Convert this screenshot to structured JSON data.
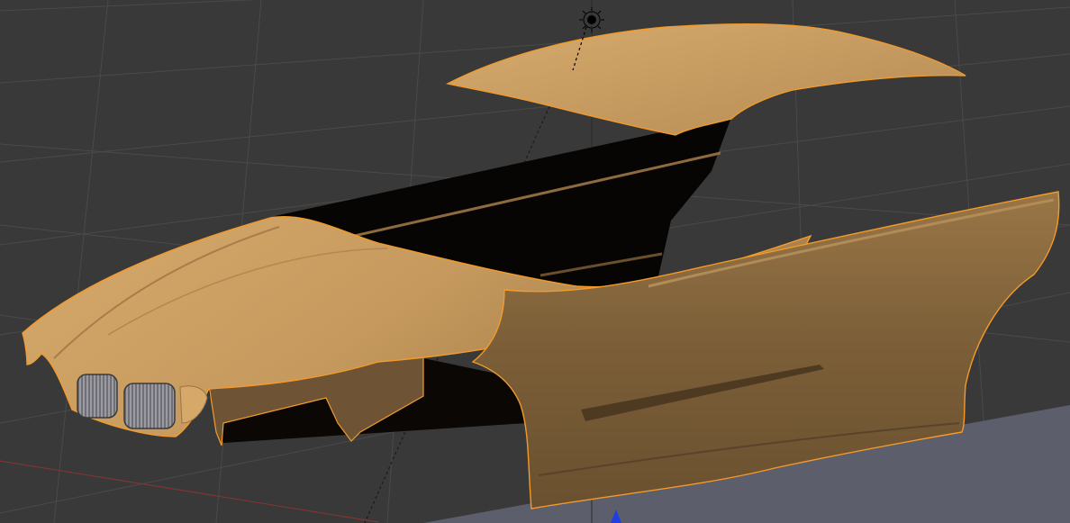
{
  "viewport": {
    "background_color": "#393939",
    "grid_line_color": "#4a4a4a",
    "x_axis_color": "#8a3434",
    "z_axis_color": "#5b7fa8",
    "ground_plane_color": "#5d5e6b"
  },
  "mesh": {
    "parts": [
      "roof",
      "hood",
      "right-side-panel",
      "left-side-panel",
      "interior"
    ],
    "body_color": "#c99a5b",
    "highlight_color": "#ddb57c",
    "shade_color": "#6b5233",
    "selection_outline_color": "#f39a2a",
    "grille_color": "#8c8c92"
  },
  "scene_objects": {
    "lamp": "light-icon",
    "origin_marker": "3d-cursor-icon",
    "transform_widget": "z-axis-arrow-icon"
  }
}
